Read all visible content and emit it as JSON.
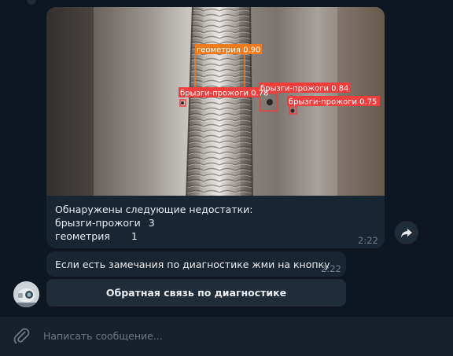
{
  "message_photo": {
    "detections": [
      {
        "label": "геометрия 0.90",
        "color": "#f07a1c"
      },
      {
        "label": "брызги-прожоги 0.84",
        "color": "#ef3e3e"
      },
      {
        "label": "брызги-прожоги 0.75",
        "color": "#ef3e3e"
      },
      {
        "label": "брызги-прожоги 0.78",
        "color": "#ef3e3e"
      }
    ],
    "caption": {
      "header": "Обнаружены следующие недостатки:",
      "items": [
        {
          "name": "брызги-прожоги",
          "count": "3"
        },
        {
          "name": "геометрия",
          "count": "1"
        }
      ]
    },
    "time": "2:22"
  },
  "message_text": {
    "text": "Если есть замечания по диагностике жми на кнопку",
    "time": "2:22"
  },
  "inline_button": {
    "label": "Обратная связь по диагностике"
  },
  "composer": {
    "placeholder": "Написать сообщение..."
  },
  "icons": {
    "share": "share-arrow-icon",
    "attach": "paperclip-icon"
  },
  "colors": {
    "background": "#0e1621",
    "bubble": "#182533",
    "composer": "#17212b",
    "button": "#1f2c3a",
    "detection_orange": "#f07a1c",
    "detection_red": "#ef3e3e"
  }
}
